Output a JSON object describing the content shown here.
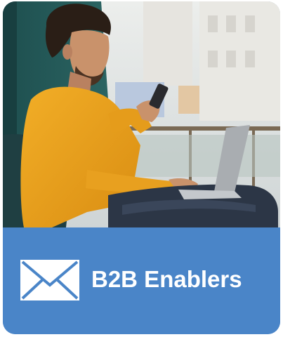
{
  "card": {
    "label": "B2B Enablers",
    "icon": "envelope-icon",
    "photo": "man-using-smartphone-with-laptop",
    "colors": {
      "banner": "#4a85c8",
      "text": "#ffffff"
    }
  }
}
